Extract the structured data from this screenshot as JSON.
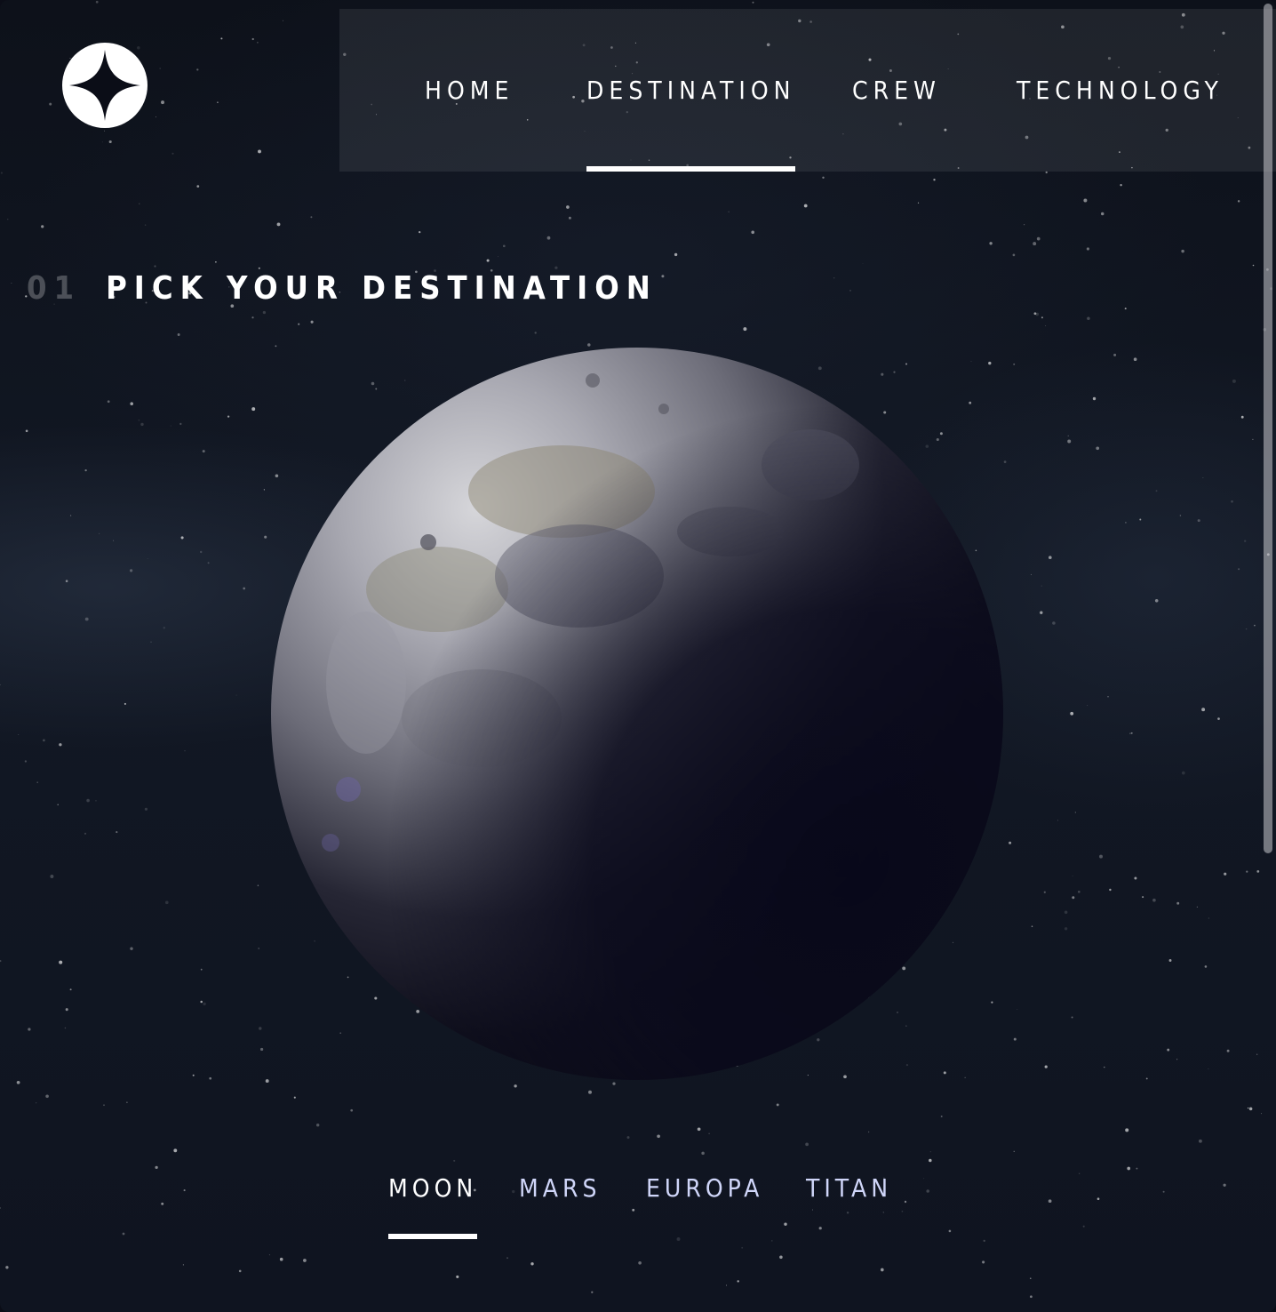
{
  "brand": {
    "logo_icon": "four-point-star-logo"
  },
  "nav": {
    "items": [
      {
        "label": "HOME",
        "active": false
      },
      {
        "label": "DESTINATION",
        "active": true
      },
      {
        "label": "CREW",
        "active": false
      },
      {
        "label": "TECHNOLOGY",
        "active": false
      }
    ]
  },
  "page": {
    "number": "01",
    "title": "PICK YOUR DESTINATION"
  },
  "destination": {
    "image_subject": "moon-planet-image",
    "tabs": [
      {
        "label": "MOON",
        "active": true
      },
      {
        "label": "MARS",
        "active": false
      },
      {
        "label": "EUROPA",
        "active": false
      },
      {
        "label": "TITAN",
        "active": false
      }
    ]
  },
  "colors": {
    "background": "#0b0d17",
    "text_primary": "#ffffff",
    "text_secondary": "#d0d6f9"
  }
}
